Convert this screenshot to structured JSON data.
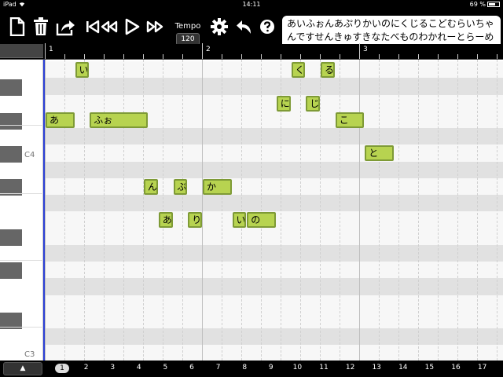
{
  "status": {
    "carrier": "iPad",
    "time": "14:11",
    "battery": "69 %",
    "battery_level": 0.69
  },
  "toolbar": {
    "icons": [
      "new-document-icon",
      "trash-icon",
      "share-icon",
      "skip-start-icon",
      "rewind-icon",
      "play-icon",
      "fast-forward-icon",
      "settings-gear-icon",
      "undo-icon",
      "help-icon"
    ],
    "tempo_label": "Tempo",
    "tempo_value": "120"
  },
  "lyrics": "あいふぉんあぷりかいのにくじるこどむらいちゃんですせんきゅすきなたべものわかれーとらーめんとぎゅうざとやきめしとあげもの",
  "ruler": {
    "bars": [
      "1",
      "2",
      "3"
    ]
  },
  "keys": {
    "labels": [
      "C4",
      "C3"
    ]
  },
  "notes": [
    {
      "text": "あ",
      "beat": 1,
      "len": 1.5,
      "pitch": "B3"
    },
    {
      "text": "い",
      "beat": 2.5,
      "len": 0.75,
      "pitch": "D4"
    },
    {
      "text": "ふぉ",
      "beat": 3.25,
      "len": 3,
      "pitch": "B3"
    },
    {
      "text": "ん",
      "beat": 6,
      "len": 0.75,
      "pitch": "G3"
    },
    {
      "text": "あ",
      "beat": 6.75,
      "len": 0.75,
      "pitch": "F3"
    },
    {
      "text": "ぷ",
      "beat": 7.5,
      "len": 0.75,
      "pitch": "G3"
    },
    {
      "text": "り",
      "beat": 8.25,
      "len": 0.75,
      "pitch": "F3"
    },
    {
      "text": "か",
      "beat": 9,
      "len": 1.5,
      "pitch": "G3"
    },
    {
      "text": "い",
      "beat": 10.5,
      "len": 0.75,
      "pitch": "F3"
    },
    {
      "text": "の",
      "beat": 11.25,
      "len": 1.5,
      "pitch": "F3"
    },
    {
      "text": "に",
      "beat": 12.75,
      "len": 0.75,
      "pitch": "C4"
    },
    {
      "text": "く",
      "beat": 13.5,
      "len": 0.75,
      "pitch": "D4"
    },
    {
      "text": "じ",
      "beat": 14.25,
      "len": 0.75,
      "pitch": "C4"
    },
    {
      "text": "る",
      "beat": 15,
      "len": 0.75,
      "pitch": "D4"
    },
    {
      "text": "こ",
      "beat": 15.75,
      "len": 1.5,
      "pitch": "B3"
    },
    {
      "text": "と",
      "beat": 17.25,
      "len": 1.5,
      "pitch": "A3"
    }
  ],
  "bottom": {
    "up_label": "▲",
    "beats": [
      "1",
      "2",
      "3",
      "4",
      "5",
      "6",
      "7",
      "8",
      "9",
      "10",
      "11",
      "12",
      "13",
      "14",
      "15",
      "16",
      "17"
    ],
    "selected_beat": "1"
  }
}
